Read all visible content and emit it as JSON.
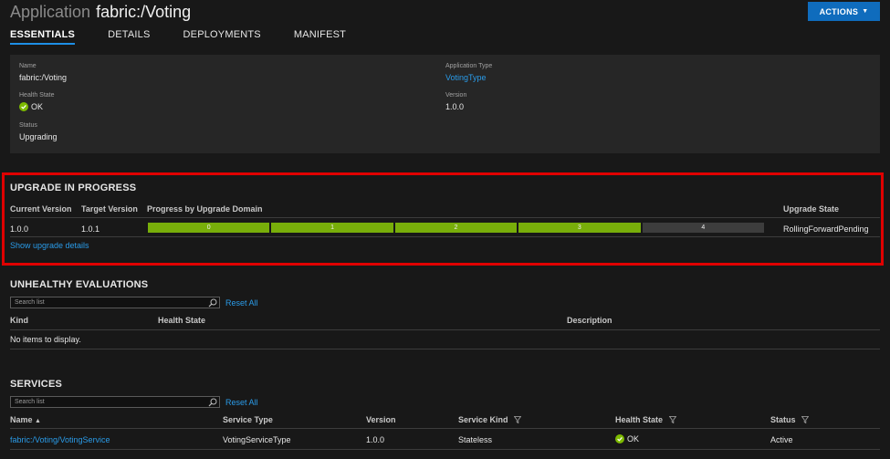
{
  "header": {
    "type": "Application",
    "name": "fabric:/Voting"
  },
  "actions": {
    "label": "ACTIONS"
  },
  "tabs": [
    "ESSENTIALS",
    "DETAILS",
    "DEPLOYMENTS",
    "MANIFEST"
  ],
  "essentials": {
    "name_label": "Name",
    "name_value": "fabric:/Voting",
    "health_label": "Health State",
    "health_value": "OK",
    "status_label": "Status",
    "status_value": "Upgrading",
    "apptype_label": "Application Type",
    "apptype_value": "VotingType",
    "version_label": "Version",
    "version_value": "1.0.0"
  },
  "upgrade": {
    "title": "UPGRADE IN PROGRESS",
    "headers": {
      "current": "Current Version",
      "target": "Target Version",
      "progress": "Progress by Upgrade Domain",
      "state": "Upgrade State"
    },
    "current": "1.0.0",
    "target": "1.0.1",
    "domains": [
      {
        "label": "0",
        "status": "completed"
      },
      {
        "label": "1",
        "status": "completed"
      },
      {
        "label": "2",
        "status": "completed"
      },
      {
        "label": "3",
        "status": "completed"
      },
      {
        "label": "4",
        "status": "pending"
      }
    ],
    "state": "RollingForwardPending",
    "details_link": "Show upgrade details"
  },
  "unhealthy": {
    "title": "UNHEALTHY EVALUATIONS",
    "search_placeholder": "Search list",
    "reset": "Reset All",
    "headers": {
      "kind": "Kind",
      "health": "Health State",
      "description": "Description"
    },
    "empty": "No items to display."
  },
  "services": {
    "title": "SERVICES",
    "search_placeholder": "Search list",
    "reset": "Reset All",
    "headers": {
      "name": "Name",
      "type": "Service Type",
      "version": "Version",
      "kind": "Service Kind",
      "health": "Health State",
      "status": "Status"
    },
    "rows": [
      {
        "name": "fabric:/Voting/VotingService",
        "type": "VotingServiceType",
        "version": "1.0.0",
        "kind": "Stateless",
        "health": "OK",
        "status": "Active"
      }
    ]
  },
  "colors": {
    "accent": "#0f6cbd",
    "link": "#2a9be8",
    "ok": "#7dba00",
    "highlight": "#e00000"
  }
}
